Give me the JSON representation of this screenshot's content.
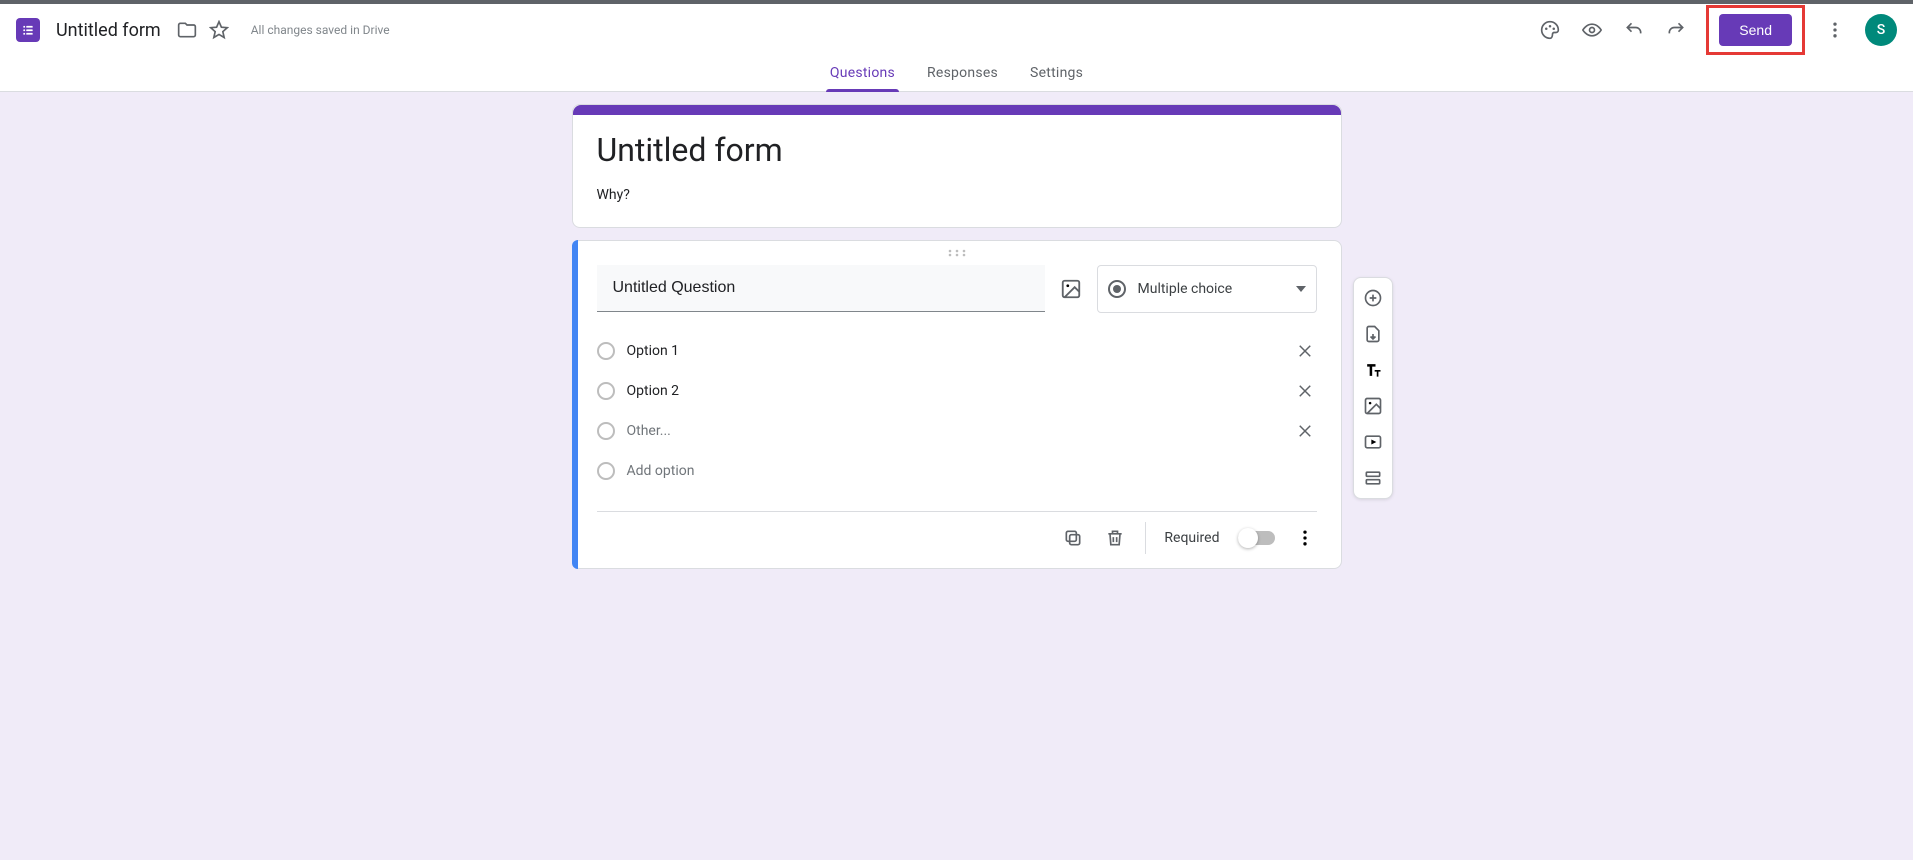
{
  "header": {
    "doc_title": "Untitled form",
    "save_status": "All changes saved in Drive",
    "send_label": "Send",
    "avatar_letter": "S"
  },
  "tabs": {
    "questions": "Questions",
    "responses": "Responses",
    "settings": "Settings"
  },
  "form": {
    "title": "Untitled form",
    "description": "Why?"
  },
  "question": {
    "text": "Untitled Question",
    "type_label": "Multiple choice",
    "options": [
      {
        "label": "Option 1",
        "removable": true
      },
      {
        "label": "Option 2",
        "removable": true
      },
      {
        "label": "Other...",
        "removable": true
      }
    ],
    "add_option": "Add option",
    "required_label": "Required"
  }
}
